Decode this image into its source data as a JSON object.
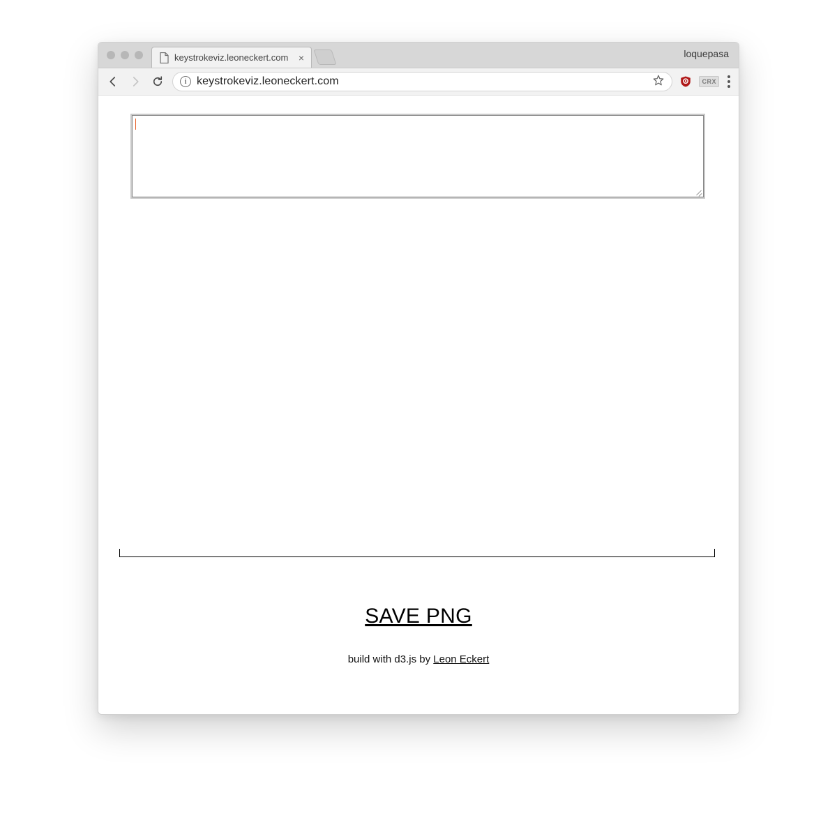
{
  "browser": {
    "tab_title": "keystrokeviz.leoneckert.com",
    "profile_name": "loquepasa",
    "url": "keystrokeviz.leoneckert.com",
    "crx_badge": "CRX"
  },
  "page": {
    "textarea_value": "",
    "save_button_label": "SAVE PNG",
    "credit_prefix": "build with d3.js by ",
    "credit_author": "Leon Eckert"
  }
}
